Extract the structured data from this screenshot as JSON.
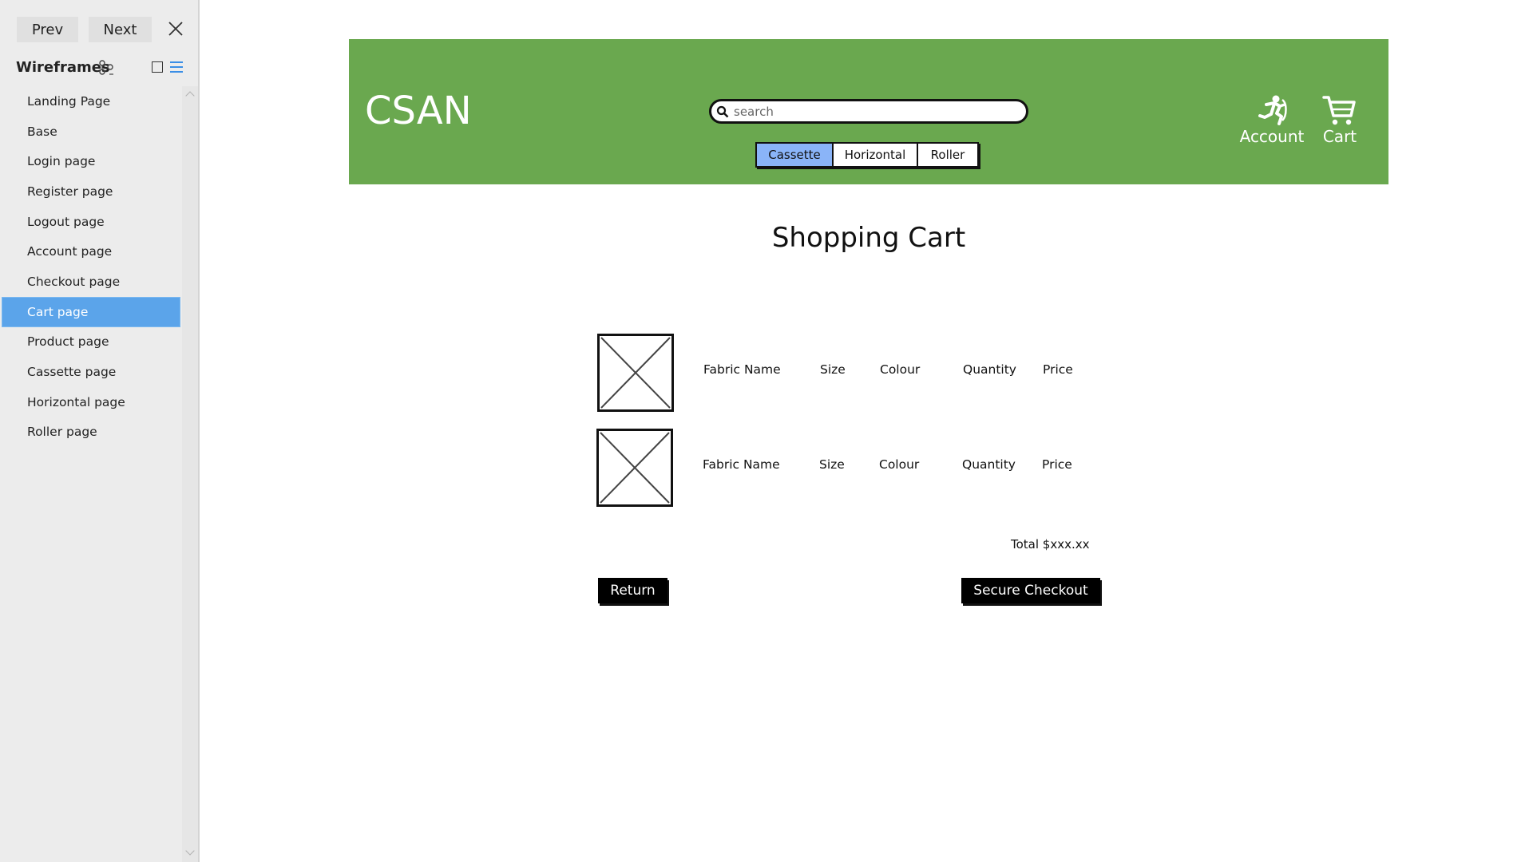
{
  "sidebar": {
    "prev_label": "Prev",
    "next_label": "Next",
    "title": "Wireframes",
    "pages": [
      {
        "label": "Landing Page"
      },
      {
        "label": "Base"
      },
      {
        "label": "Login page"
      },
      {
        "label": "Register page"
      },
      {
        "label": "Logout page"
      },
      {
        "label": "Account page"
      },
      {
        "label": "Checkout page"
      },
      {
        "label": "Cart page",
        "active": true
      },
      {
        "label": "Product page"
      },
      {
        "label": "Cassette page"
      },
      {
        "label": "Horizontal page"
      },
      {
        "label": "Roller page"
      }
    ]
  },
  "header": {
    "logo": "CSAN",
    "search_placeholder": "search",
    "tabs": [
      {
        "label": "Cassette",
        "active": true
      },
      {
        "label": "Horizontal"
      },
      {
        "label": "Roller"
      }
    ],
    "account_label": "Account",
    "cart_label": "Cart"
  },
  "main": {
    "title": "Shopping Cart",
    "rows": [
      {
        "fabric": "Fabric Name",
        "size": "Size",
        "colour": "Colour",
        "quantity": "Quantity",
        "price": "Price"
      },
      {
        "fabric": "Fabric Name",
        "size": "Size",
        "colour": "Colour",
        "quantity": "Quantity",
        "price": "Price"
      }
    ],
    "total": "Total $xxx.xx",
    "return_label": "Return",
    "checkout_label": "Secure Checkout"
  },
  "colors": {
    "header_bg": "#6aa84f",
    "active_tab": "#8ab4f8",
    "active_page": "#5ba4ea"
  }
}
